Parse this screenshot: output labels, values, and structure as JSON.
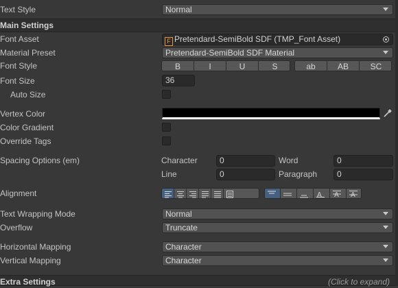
{
  "text_style": {
    "label": "Text Style",
    "value": "Normal"
  },
  "main_settings": {
    "title": "Main Settings"
  },
  "font_asset": {
    "label": "Font Asset",
    "value": "Pretendard-SemiBold SDF (TMP_Font Asset)"
  },
  "material_preset": {
    "label": "Material Preset",
    "value": "Pretendard-SemiBold SDF Material"
  },
  "font_style": {
    "label": "Font Style",
    "buttons": [
      "B",
      "I",
      "U",
      "S",
      "ab",
      "AB",
      "SC"
    ]
  },
  "font_size": {
    "label": "Font Size",
    "value": "36"
  },
  "auto_size": {
    "label": "Auto Size"
  },
  "vertex_color": {
    "label": "Vertex Color",
    "color": "#000000"
  },
  "color_gradient": {
    "label": "Color Gradient"
  },
  "override_tags": {
    "label": "Override Tags"
  },
  "spacing": {
    "label": "Spacing Options (em)",
    "character_label": "Character",
    "character_value": "0",
    "word_label": "Word",
    "word_value": "0",
    "line_label": "Line",
    "line_value": "0",
    "paragraph_label": "Paragraph",
    "paragraph_value": "0"
  },
  "alignment": {
    "label": "Alignment",
    "selected_horizontal": "left",
    "selected_vertical": "top"
  },
  "text_wrapping": {
    "label": "Text Wrapping Mode",
    "value": "Normal"
  },
  "overflow": {
    "label": "Overflow",
    "value": "Truncate"
  },
  "horizontal_mapping": {
    "label": "Horizontal Mapping",
    "value": "Character"
  },
  "vertical_mapping": {
    "label": "Vertical Mapping",
    "value": "Character"
  },
  "extra_settings": {
    "title": "Extra Settings",
    "hint": "(Click to expand)"
  },
  "colors": {
    "background": "#383838",
    "header": "#2f2f2f",
    "selected": "#46607f"
  }
}
